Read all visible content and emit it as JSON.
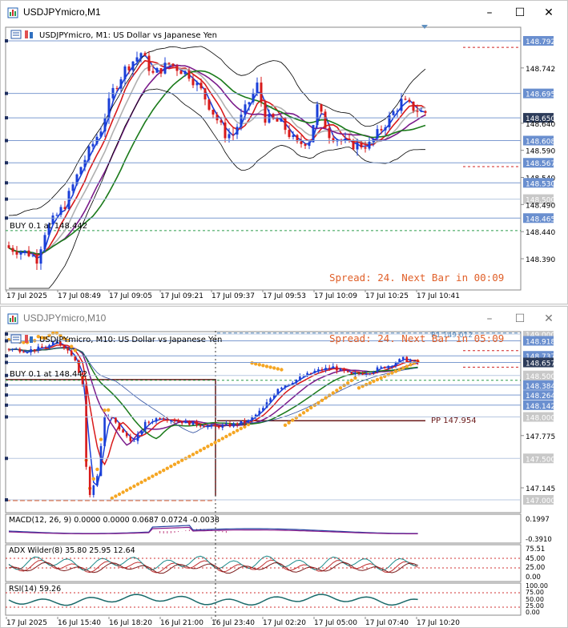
{
  "windows": [
    {
      "title": "USDJPYmicro,M1",
      "chart_info": "USDJPYmicro, M1:  US Dollar vs Japanese Yen",
      "spread_text": "Spread: 24. Next Bar in 00:09",
      "buy_label": "BUY 0.1 at 148.442",
      "controls": {
        "minimize": "–",
        "maximize": "☐",
        "close": "✕"
      },
      "price_labels": [
        {
          "text": "148.792",
          "boxed": true
        },
        {
          "text": "148.742",
          "boxed": false
        },
        {
          "text": "148.695",
          "boxed": true
        },
        {
          "text": "148.650",
          "boxed": true,
          "dark": true
        },
        {
          "text": "148.640",
          "boxed": false
        },
        {
          "text": "148.608",
          "boxed": true
        },
        {
          "text": "148.590",
          "boxed": false
        },
        {
          "text": "148.567",
          "boxed": true
        },
        {
          "text": "148.540",
          "boxed": false
        },
        {
          "text": "148.530",
          "boxed": true
        },
        {
          "text": "148.500",
          "boxed": true,
          "grey": true
        },
        {
          "text": "148.490",
          "boxed": false
        },
        {
          "text": "148.465",
          "boxed": true
        },
        {
          "text": "148.440",
          "boxed": false
        },
        {
          "text": "148.390",
          "boxed": false
        }
      ],
      "time_labels": [
        "17 Jul 2025",
        "17 Jul 08:49",
        "17 Jul 09:05",
        "17 Jul 09:21",
        "17 Jul 09:37",
        "17 Jul 09:53",
        "17 Jul 10:09",
        "17 Jul 10:25",
        "17 Jul 10:41"
      ]
    },
    {
      "title": "USDJPYmicro,M10",
      "chart_info": "USDJPYmicro, M10:  US Dollar vs Japanese Yen",
      "spread_text": "Spread: 24. Next Bar in 05:09",
      "buy_label": "BUY 0.1 at 148.442",
      "pp_label": "PP 147.954",
      "r1_label": "R1 149.012",
      "controls": {
        "minimize": "–",
        "maximize": "☐",
        "close": "✕"
      },
      "price_labels": [
        {
          "text": "149.000",
          "boxed": true,
          "grey": true
        },
        {
          "text": "148.918",
          "boxed": true
        },
        {
          "text": "148.737",
          "boxed": true
        },
        {
          "text": "148.657",
          "boxed": true,
          "dark": true
        },
        {
          "text": "148.500",
          "boxed": true,
          "grey": true
        },
        {
          "text": "148.384",
          "boxed": true
        },
        {
          "text": "148.264",
          "boxed": true
        },
        {
          "text": "148.142",
          "boxed": true
        },
        {
          "text": "148.000",
          "boxed": true,
          "grey": true
        },
        {
          "text": "147.775",
          "boxed": false
        },
        {
          "text": "147.500",
          "boxed": true,
          "grey": true
        },
        {
          "text": "147.145",
          "boxed": false
        },
        {
          "text": "147.000",
          "boxed": true,
          "grey": true
        }
      ],
      "macd_label": "MACD(12, 26, 9) 0.0000 0.0000 0.0687 0.0724 -0.0038",
      "macd_scale": [
        "0.1997",
        "-0.3910"
      ],
      "adx_label": "ADX Wilder(8) 35.80 25.95 12.64",
      "adx_scale": [
        "75.51",
        "45.00",
        "25.00",
        "0.00"
      ],
      "rsi_label": "RSI(14) 59.26",
      "rsi_scale": [
        "100.00",
        "75.00",
        "50.00",
        "25.00",
        "0.00"
      ],
      "time_labels": [
        "17 Jul 2025",
        "16 Jul 15:40",
        "16 Jul 18:20",
        "16 Jul 21:00",
        "16 Jul 23:40",
        "17 Jul 02:20",
        "17 Jul 05:00",
        "17 Jul 07:40",
        "17 Jul 10:20"
      ]
    }
  ]
}
